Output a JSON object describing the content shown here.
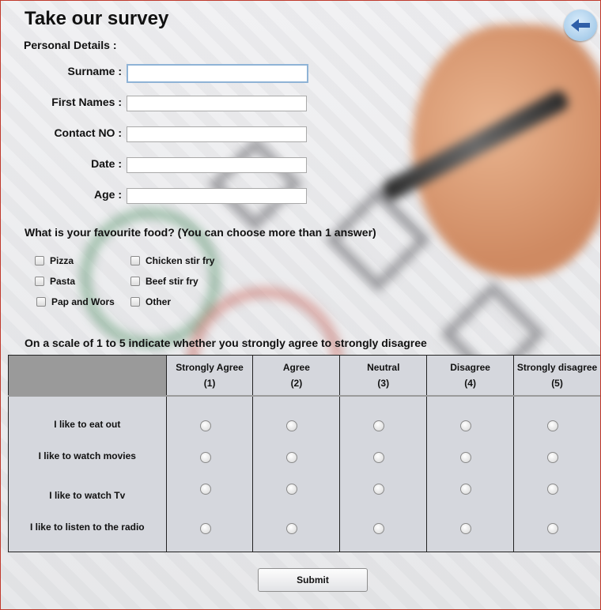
{
  "header": {
    "title": "Take our survey",
    "back_icon": "back-arrow-icon"
  },
  "personal": {
    "heading": "Personal Details :",
    "fields": [
      {
        "label": "Surname :",
        "value": ""
      },
      {
        "label": "First Names :",
        "value": ""
      },
      {
        "label": "Contact NO :",
        "value": ""
      },
      {
        "label": "Date :",
        "value": ""
      },
      {
        "label": "Age :",
        "value": ""
      }
    ]
  },
  "food": {
    "question": "What is your favourite food? (You can choose more than 1 answer)",
    "options": [
      "Pizza",
      "Pasta",
      "Pap and Wors",
      "Chicken stir fry",
      "Beef stir fry",
      "Other"
    ]
  },
  "scale": {
    "instruction": "On a scale of 1 to 5 indicate whether you strongly agree to strongly disagree",
    "columns": [
      {
        "name": "Strongly Agree",
        "num": "(1)"
      },
      {
        "name": "Agree",
        "num": "(2)"
      },
      {
        "name": "Neutral",
        "num": "(3)"
      },
      {
        "name": "Disagree",
        "num": "(4)"
      },
      {
        "name": "Strongly disagree",
        "num": "(5)"
      }
    ],
    "statements": [
      "I like to eat out",
      "I like to watch movies",
      "I like to watch Tv",
      "I like to listen to the radio"
    ]
  },
  "actions": {
    "submit_label": "Submit"
  },
  "colors": {
    "accent": "#2f5fa8",
    "frame": "#c0392b",
    "table_bg": "#d5d7dd"
  }
}
